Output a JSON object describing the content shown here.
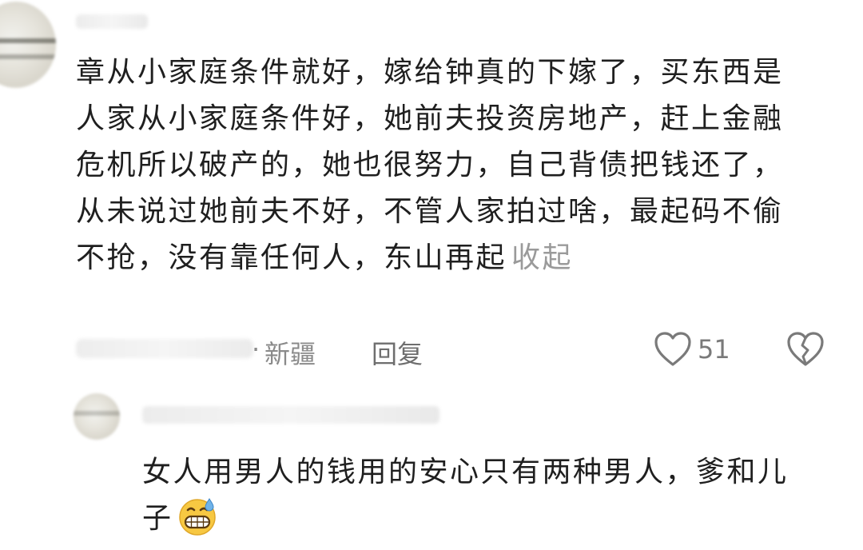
{
  "comment": {
    "text": "章从小家庭条件就好，嫁给钟真的下嫁了，买东西是人家从小家庭条件好，她前夫投资房地产，赶上金融危机所以破产的，她也很努力，自己背债把钱还了，从未说过她前夫不好，不管人家拍过啥，最起码不偷不抢，没有靠任何人，东山再起",
    "collapse_label": "收起",
    "meta_separator": "·",
    "location": "新疆",
    "reply_label": "回复",
    "like_count": "51",
    "like_icon": "heart-outline-icon",
    "dislike_icon": "broken-heart-icon"
  },
  "reply": {
    "text": "女人用男人的钱用的安心只有两种男人，爹和儿子",
    "emoji": "grinning-sweat-emoji"
  },
  "colors": {
    "text": "#1f1f1f",
    "muted": "#8a8a8a",
    "emoji_face": "#f7c842",
    "sweat_drop": "#6fb3e8"
  }
}
